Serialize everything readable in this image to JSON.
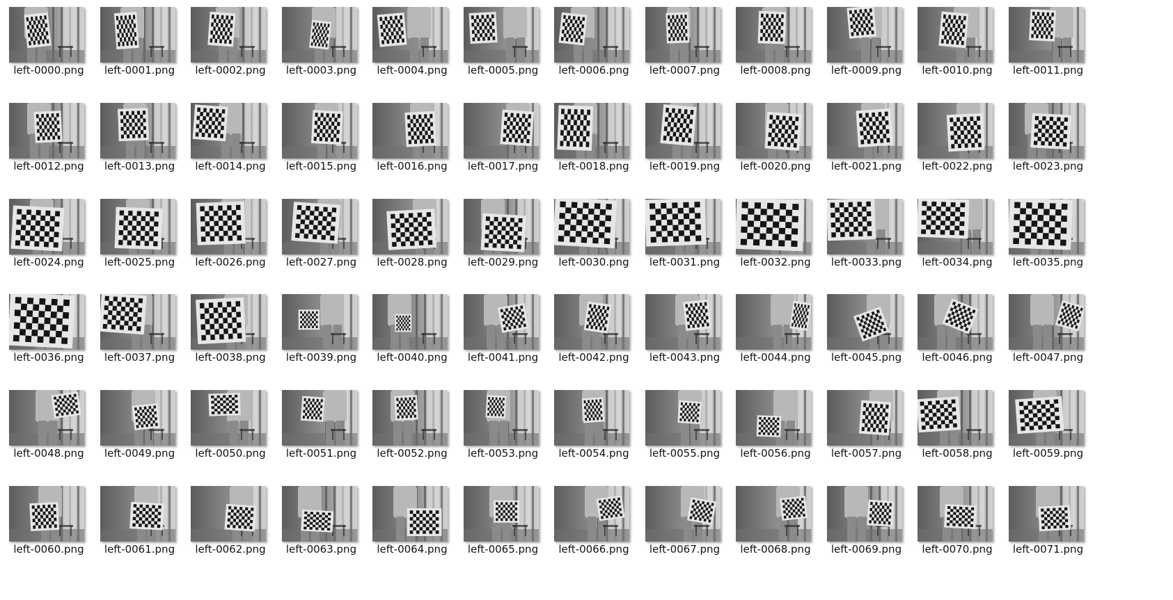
{
  "files": [
    {
      "name": "left-0000.png",
      "board": [
        0.22,
        0.12,
        0.32,
        0.6,
        -6
      ]
    },
    {
      "name": "left-0001.png",
      "board": [
        0.2,
        0.1,
        0.3,
        0.65,
        -4
      ]
    },
    {
      "name": "left-0002.png",
      "board": [
        0.24,
        0.1,
        0.34,
        0.6,
        4
      ]
    },
    {
      "name": "left-0003.png",
      "board": [
        0.38,
        0.25,
        0.26,
        0.5,
        6
      ]
    },
    {
      "name": "left-0004.png",
      "board": [
        0.08,
        0.12,
        0.36,
        0.58,
        -5
      ]
    },
    {
      "name": "left-0005.png",
      "board": [
        0.08,
        0.1,
        0.36,
        0.55,
        -3
      ]
    },
    {
      "name": "left-0006.png",
      "board": [
        0.08,
        0.12,
        0.34,
        0.55,
        6
      ]
    },
    {
      "name": "left-0007.png",
      "board": [
        0.28,
        0.1,
        0.3,
        0.55,
        -2
      ]
    },
    {
      "name": "left-0008.png",
      "board": [
        0.3,
        0.08,
        0.36,
        0.58,
        2
      ]
    },
    {
      "name": "left-0009.png",
      "board": [
        0.28,
        0.0,
        0.36,
        0.55,
        -5
      ]
    },
    {
      "name": "left-0010.png",
      "board": [
        0.3,
        0.1,
        0.36,
        0.62,
        5
      ]
    },
    {
      "name": "left-0011.png",
      "board": [
        0.28,
        0.05,
        0.34,
        0.56,
        3
      ]
    },
    {
      "name": "left-0012.png",
      "board": [
        0.34,
        0.15,
        0.36,
        0.56,
        -3
      ]
    },
    {
      "name": "left-0013.png",
      "board": [
        0.24,
        0.1,
        0.4,
        0.58,
        -2
      ]
    },
    {
      "name": "left-0014.png",
      "board": [
        0.04,
        0.05,
        0.44,
        0.62,
        4
      ]
    },
    {
      "name": "left-0015.png",
      "board": [
        0.4,
        0.14,
        0.4,
        0.6,
        3
      ]
    },
    {
      "name": "left-0016.png",
      "board": [
        0.44,
        0.16,
        0.4,
        0.62,
        -3
      ]
    },
    {
      "name": "left-0017.png",
      "board": [
        0.5,
        0.14,
        0.42,
        0.62,
        4
      ]
    },
    {
      "name": "left-0018.png",
      "board": [
        0.05,
        0.05,
        0.46,
        0.8,
        2
      ]
    },
    {
      "name": "left-0019.png",
      "board": [
        0.22,
        0.05,
        0.44,
        0.7,
        5
      ]
    },
    {
      "name": "left-0020.png",
      "board": [
        0.4,
        0.18,
        0.46,
        0.66,
        4
      ]
    },
    {
      "name": "left-0021.png",
      "board": [
        0.4,
        0.12,
        0.46,
        0.66,
        -4
      ]
    },
    {
      "name": "left-0022.png",
      "board": [
        0.4,
        0.2,
        0.48,
        0.66,
        -3
      ]
    },
    {
      "name": "left-0023.png",
      "board": [
        0.3,
        0.2,
        0.52,
        0.62,
        3
      ]
    },
    {
      "name": "left-0024.png",
      "board": [
        0.04,
        0.14,
        0.68,
        0.78,
        3
      ]
    },
    {
      "name": "left-0025.png",
      "board": [
        0.2,
        0.16,
        0.62,
        0.74,
        2
      ]
    },
    {
      "name": "left-0026.png",
      "board": [
        0.08,
        0.06,
        0.64,
        0.76,
        -2
      ]
    },
    {
      "name": "left-0027.png",
      "board": [
        0.14,
        0.08,
        0.62,
        0.7,
        4
      ]
    },
    {
      "name": "left-0028.png",
      "board": [
        0.2,
        0.2,
        0.64,
        0.7,
        -3
      ]
    },
    {
      "name": "left-0029.png",
      "board": [
        0.24,
        0.28,
        0.58,
        0.66,
        3
      ]
    },
    {
      "name": "left-0030.png",
      "board": [
        0.0,
        0.0,
        0.82,
        0.86,
        3
      ]
    },
    {
      "name": "left-0031.png",
      "board": [
        0.0,
        0.0,
        0.8,
        0.84,
        -2
      ]
    },
    {
      "name": "left-0032.png",
      "board": [
        0.0,
        0.0,
        0.9,
        0.92,
        2
      ]
    },
    {
      "name": "left-0033.png",
      "board": [
        0.0,
        0.0,
        0.64,
        0.74,
        -2
      ]
    },
    {
      "name": "left-0034.png",
      "board": [
        0.0,
        0.0,
        0.68,
        0.7,
        2
      ]
    },
    {
      "name": "left-0035.png",
      "board": [
        0.0,
        0.0,
        0.84,
        0.9,
        2
      ]
    },
    {
      "name": "left-0036.png",
      "board": [
        0.0,
        0.0,
        0.86,
        0.95,
        3
      ]
    },
    {
      "name": "left-0037.png",
      "board": [
        0.0,
        0.0,
        0.6,
        0.7,
        4
      ]
    },
    {
      "name": "left-0038.png",
      "board": [
        0.08,
        0.08,
        0.64,
        0.8,
        -3
      ]
    },
    {
      "name": "left-0039.png",
      "board": [
        0.22,
        0.28,
        0.28,
        0.36,
        0
      ]
    },
    {
      "name": "left-0040.png",
      "board": [
        0.3,
        0.36,
        0.22,
        0.32,
        0
      ]
    },
    {
      "name": "left-0041.png",
      "board": [
        0.48,
        0.2,
        0.36,
        0.46,
        -10
      ]
    },
    {
      "name": "left-0042.png",
      "board": [
        0.42,
        0.16,
        0.32,
        0.52,
        8
      ]
    },
    {
      "name": "left-0043.png",
      "board": [
        0.52,
        0.12,
        0.34,
        0.52,
        -6
      ]
    },
    {
      "name": "left-0044.png",
      "board": [
        0.74,
        0.14,
        0.24,
        0.5,
        8
      ]
    },
    {
      "name": "left-0045.png",
      "board": [
        0.4,
        0.3,
        0.38,
        0.48,
        -20
      ]
    },
    {
      "name": "left-0046.png",
      "board": [
        0.38,
        0.16,
        0.38,
        0.48,
        22
      ]
    },
    {
      "name": "left-0047.png",
      "board": [
        0.66,
        0.16,
        0.32,
        0.46,
        16
      ]
    },
    {
      "name": "left-0048.png",
      "board": [
        0.58,
        0.06,
        0.36,
        0.42,
        -8
      ]
    },
    {
      "name": "left-0049.png",
      "board": [
        0.44,
        0.26,
        0.34,
        0.44,
        -6
      ]
    },
    {
      "name": "left-0050.png",
      "board": [
        0.24,
        0.06,
        0.42,
        0.4,
        -2
      ]
    },
    {
      "name": "left-0051.png",
      "board": [
        0.26,
        0.12,
        0.3,
        0.44,
        4
      ]
    },
    {
      "name": "left-0052.png",
      "board": [
        0.3,
        0.1,
        0.3,
        0.44,
        -3
      ]
    },
    {
      "name": "left-0053.png",
      "board": [
        0.3,
        0.1,
        0.26,
        0.4,
        3
      ]
    },
    {
      "name": "left-0054.png",
      "board": [
        0.38,
        0.14,
        0.28,
        0.44,
        -4
      ]
    },
    {
      "name": "left-0055.png",
      "board": [
        0.44,
        0.2,
        0.3,
        0.4,
        4
      ]
    },
    {
      "name": "left-0056.png",
      "board": [
        0.28,
        0.46,
        0.32,
        0.38,
        2
      ]
    },
    {
      "name": "left-0057.png",
      "board": [
        0.44,
        0.2,
        0.4,
        0.6,
        4
      ]
    },
    {
      "name": "left-0058.png",
      "board": [
        0.0,
        0.14,
        0.56,
        0.6,
        -4
      ]
    },
    {
      "name": "left-0059.png",
      "board": [
        0.1,
        0.14,
        0.62,
        0.62,
        -4
      ]
    },
    {
      "name": "left-0060.png",
      "board": [
        0.28,
        0.3,
        0.38,
        0.5,
        -3
      ]
    },
    {
      "name": "left-0061.png",
      "board": [
        0.4,
        0.3,
        0.44,
        0.48,
        3
      ]
    },
    {
      "name": "left-0062.png",
      "board": [
        0.46,
        0.34,
        0.4,
        0.46,
        4
      ]
    },
    {
      "name": "left-0063.png",
      "board": [
        0.26,
        0.44,
        0.42,
        0.38,
        3
      ]
    },
    {
      "name": "left-0064.png",
      "board": [
        0.46,
        0.4,
        0.46,
        0.5,
        0
      ]
    },
    {
      "name": "left-0065.png",
      "board": [
        0.4,
        0.26,
        0.34,
        0.4,
        0
      ]
    },
    {
      "name": "left-0066.png",
      "board": [
        0.58,
        0.2,
        0.34,
        0.4,
        -8
      ]
    },
    {
      "name": "left-0067.png",
      "board": [
        0.58,
        0.24,
        0.34,
        0.42,
        10
      ]
    },
    {
      "name": "left-0068.png",
      "board": [
        0.6,
        0.2,
        0.34,
        0.4,
        -6
      ]
    },
    {
      "name": "left-0069.png",
      "board": [
        0.54,
        0.26,
        0.34,
        0.46,
        4
      ]
    },
    {
      "name": "left-0070.png",
      "board": [
        0.36,
        0.34,
        0.42,
        0.42,
        3
      ]
    },
    {
      "name": "left-0071.png",
      "board": [
        0.4,
        0.36,
        0.42,
        0.44,
        -3
      ]
    }
  ]
}
